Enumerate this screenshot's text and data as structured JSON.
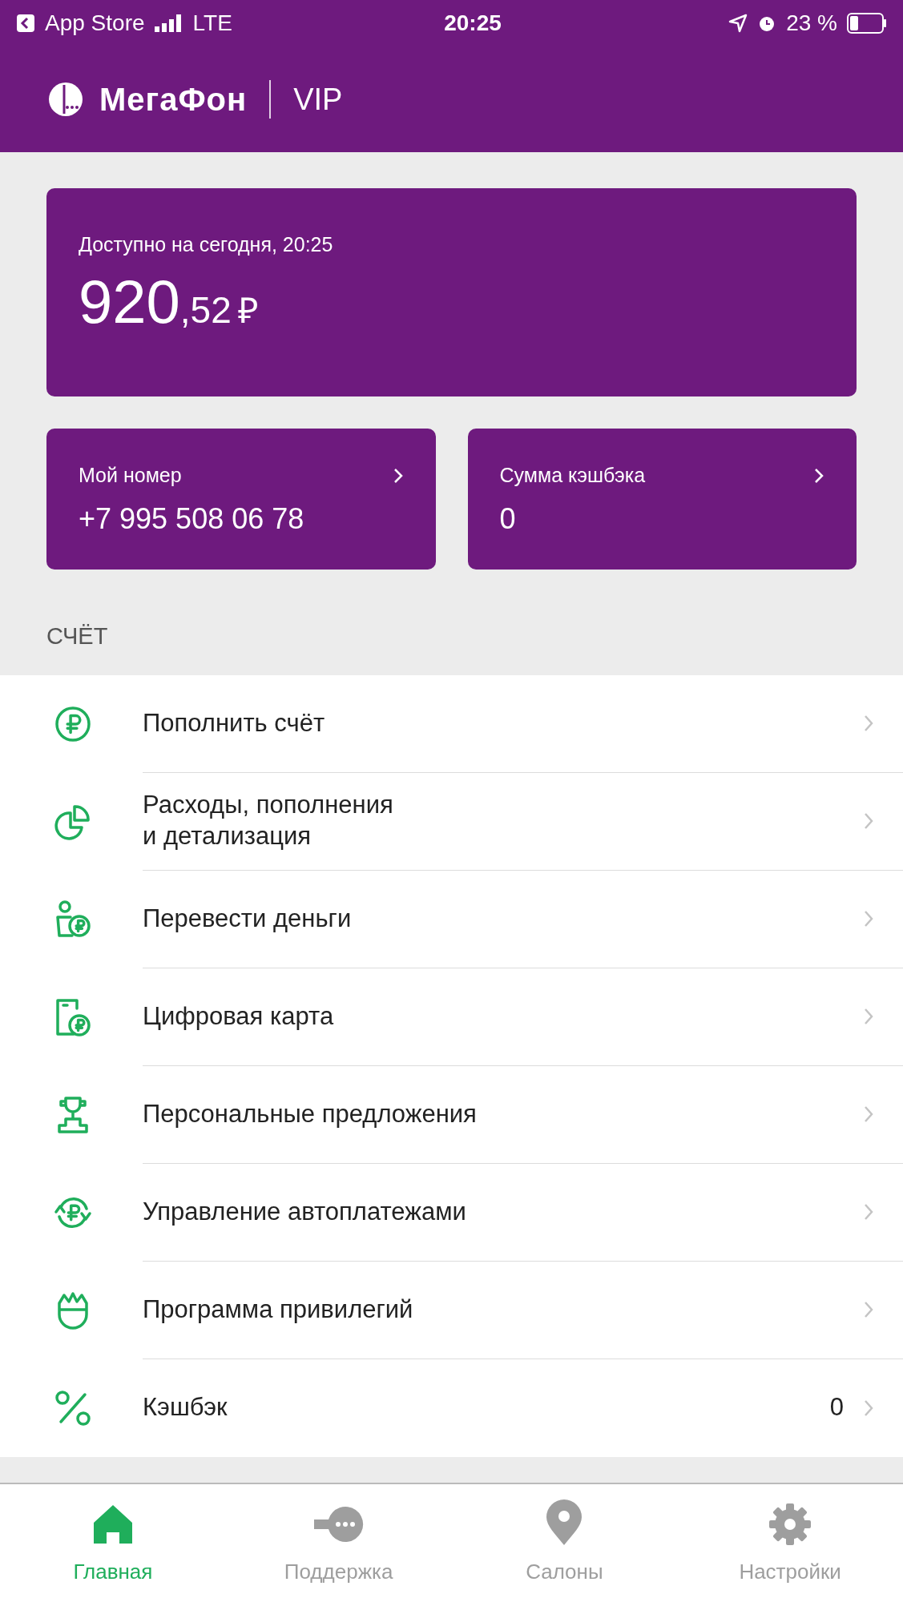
{
  "status_bar": {
    "back_app": "App Store",
    "network": "LTE",
    "time": "20:25",
    "battery": "23 %"
  },
  "header": {
    "brand": "МегаФон",
    "tier": "VIP"
  },
  "balance": {
    "label": "Доступно на сегодня, 20:25",
    "integer": "920",
    "fraction": ",52",
    "currency": "₽"
  },
  "cards": [
    {
      "label": "Мой номер",
      "value": "+7 995 508 06 78"
    },
    {
      "label": "Сумма кэшбэка",
      "value": "0"
    }
  ],
  "section_title": "СЧЁТ",
  "menu": [
    {
      "kind": "ruble",
      "label": "Пополнить счёт"
    },
    {
      "kind": "pie",
      "label": "Расходы, пополнения\nи детализация"
    },
    {
      "kind": "transfer",
      "label": "Перевести деньги"
    },
    {
      "kind": "card",
      "label": "Цифровая карта"
    },
    {
      "kind": "trophy",
      "label": "Персональные предложения"
    },
    {
      "kind": "autopay",
      "label": "Управление автоплатежами"
    },
    {
      "kind": "crown",
      "label": "Программа привилегий"
    },
    {
      "kind": "percent",
      "label": "Кэшбэк",
      "value": "0"
    }
  ],
  "tabs": [
    {
      "kind": "home",
      "label": "Главная",
      "selected": true
    },
    {
      "kind": "support",
      "label": "Поддержка",
      "selected": false
    },
    {
      "kind": "pin",
      "label": "Салоны",
      "selected": false
    },
    {
      "kind": "gear",
      "label": "Настройки",
      "selected": false
    }
  ]
}
